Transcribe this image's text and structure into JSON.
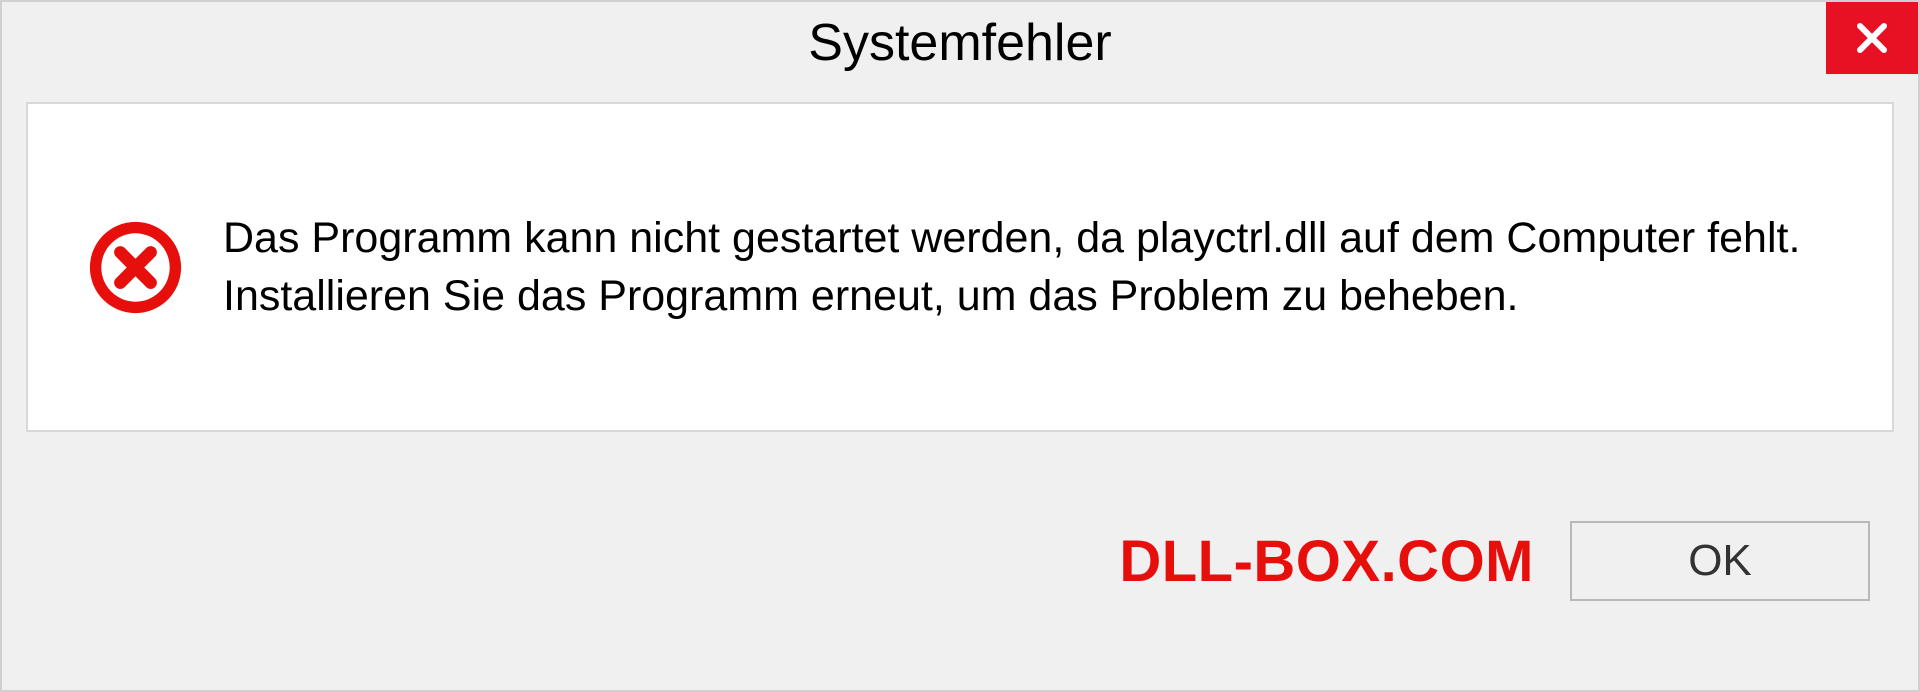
{
  "dialog": {
    "title": "Systemfehler",
    "message": "Das Programm kann nicht gestartet werden, da playctrl.dll auf dem Computer fehlt. Installieren Sie das Programm erneut, um das Problem zu beheben.",
    "ok_label": "OK"
  },
  "watermark": "DLL-BOX.COM"
}
